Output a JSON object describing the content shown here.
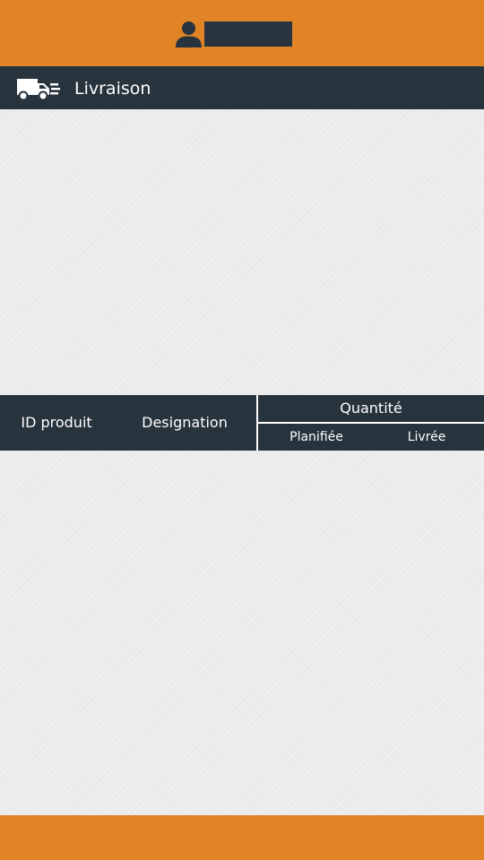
{
  "header": {
    "user_icon": "user-icon",
    "user_name": ""
  },
  "title_bar": {
    "icon": "delivery-truck-icon",
    "title": "Livraison"
  },
  "table": {
    "columns": {
      "id_produit": "ID produit",
      "designation": "Designation",
      "quantite": "Quantité",
      "planifiee": "Planifiée",
      "livree": "Livrée"
    },
    "rows": []
  },
  "colors": {
    "accent": "#e08426",
    "dark": "#27333d",
    "background": "#ececec"
  }
}
